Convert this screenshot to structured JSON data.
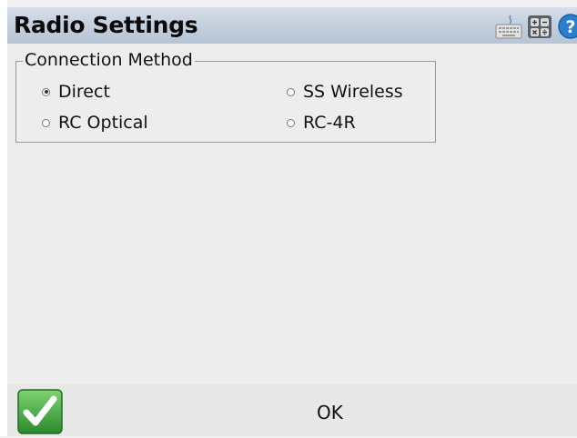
{
  "window": {
    "title": "Radio Settings"
  },
  "toolbar": {
    "icons": [
      "keyboard-icon",
      "calculator-icon",
      "help-icon"
    ]
  },
  "group": {
    "label": "Connection Method",
    "options": [
      {
        "label": "Direct",
        "selected": true
      },
      {
        "label": "SS Wireless",
        "selected": false
      },
      {
        "label": "RC Optical",
        "selected": false
      },
      {
        "label": "RC-4R",
        "selected": false
      }
    ]
  },
  "footer": {
    "ok_label": "OK"
  },
  "colors": {
    "titlebar": "#c3cfdd",
    "accept_green": "#3aa33a"
  }
}
